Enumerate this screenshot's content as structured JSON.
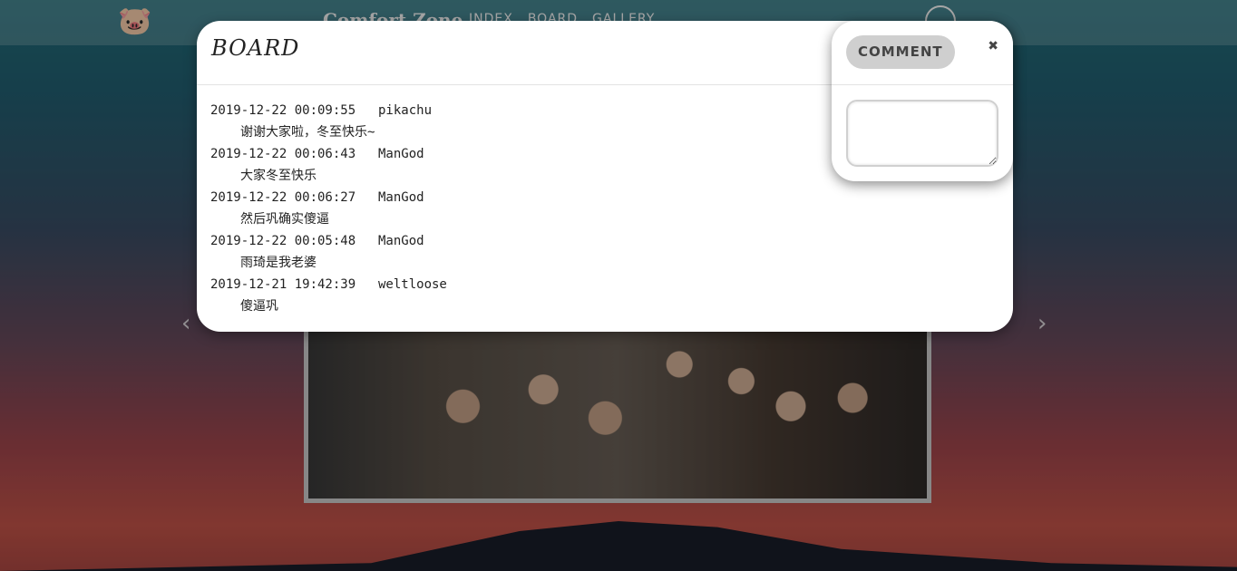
{
  "navbar": {
    "logo_icon": "pig-logo-icon",
    "brand": "Comfort Zone",
    "links": [
      "INDEX",
      "BOARD",
      "GALLERY"
    ],
    "user_icon": "user-avatar-icon"
  },
  "carousel": {
    "prev_icon": "chevron-left-icon",
    "next_icon": "chevron-right-icon"
  },
  "board": {
    "title": "BOARD",
    "posts": [
      {
        "time": "2019-12-22 00:09:55",
        "user": "pikachu",
        "message": "谢谢大家啦，冬至快乐~"
      },
      {
        "time": "2019-12-22 00:06:43",
        "user": "ManGod",
        "message": "大家冬至快乐"
      },
      {
        "time": "2019-12-22 00:06:27",
        "user": "ManGod",
        "message": "然后巩确实傻逼"
      },
      {
        "time": "2019-12-22 00:05:48",
        "user": "ManGod",
        "message": "雨琦是我老婆"
      },
      {
        "time": "2019-12-21 19:42:39",
        "user": "weltloose",
        "message": "傻逼巩"
      }
    ]
  },
  "comment": {
    "button_label": "COMMENT",
    "close_glyph": "✖",
    "textarea_value": ""
  }
}
